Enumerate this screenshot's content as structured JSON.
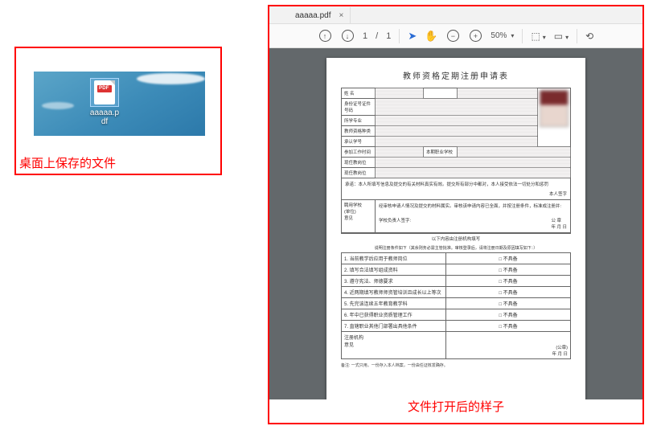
{
  "desktop": {
    "file_label": "aaaaa.pdf"
  },
  "left_caption": "桌面上保存的文件",
  "right_caption": "文件打开后的样子",
  "tab": {
    "title": "aaaaa.pdf",
    "close": "×"
  },
  "toolbar": {
    "page_current": "1",
    "page_sep": "/",
    "page_total": "1",
    "zoom": "50%"
  },
  "doc": {
    "title": "教师资格定期注册申请表",
    "row_labels": [
      "姓  名",
      "身份证号证件号码",
      "所学专业",
      "教师资格种类",
      "承认学号",
      "参加工作时间",
      "本期职业学校",
      "现任教岗位"
    ],
    "declare": "承诺：本人所填写信息及提交的有关材料真实有效。提交所有部分中都对，本人接受依法一切处分和惩罚",
    "sign_label": "本人签字",
    "school_block_label": "聘用学校\n(单位)\n意见",
    "school_block_text": "经审核申请人情况及提交的材料属实。审核该申请内容已全面，并按注册条件，标准成注册并:",
    "school_block_sign": "学校负责人签字:",
    "seal": "公  章",
    "date": "年    月    日",
    "mid_banner": "以下内容由注册机构填写",
    "mid_note": "说明注册条件如下（其余则务必需主管批准。审核登录后，请将注册日期及原因填写如下：）",
    "items": [
      "1. 当前教学后应用于教师岗位",
      "2. 填写合法填写组成资料",
      "3. 遵守宪法、师德要求",
      "4. 近两期填写教师师资管培训且成长以上等次",
      "5. 先完该连续五年教育教学科",
      "6. 年中已获得职业资质管理工作",
      "7. 直辖职业其他门部署出具他条件"
    ],
    "check_opt": "□ 不具备",
    "reg_block_label": "注册机构\n意见",
    "reg_seal": "(公章)",
    "reg_date": "年    月    日",
    "foot": "备注: 一式只用。一份存入本人档案，一份由任证核发确存。"
  }
}
